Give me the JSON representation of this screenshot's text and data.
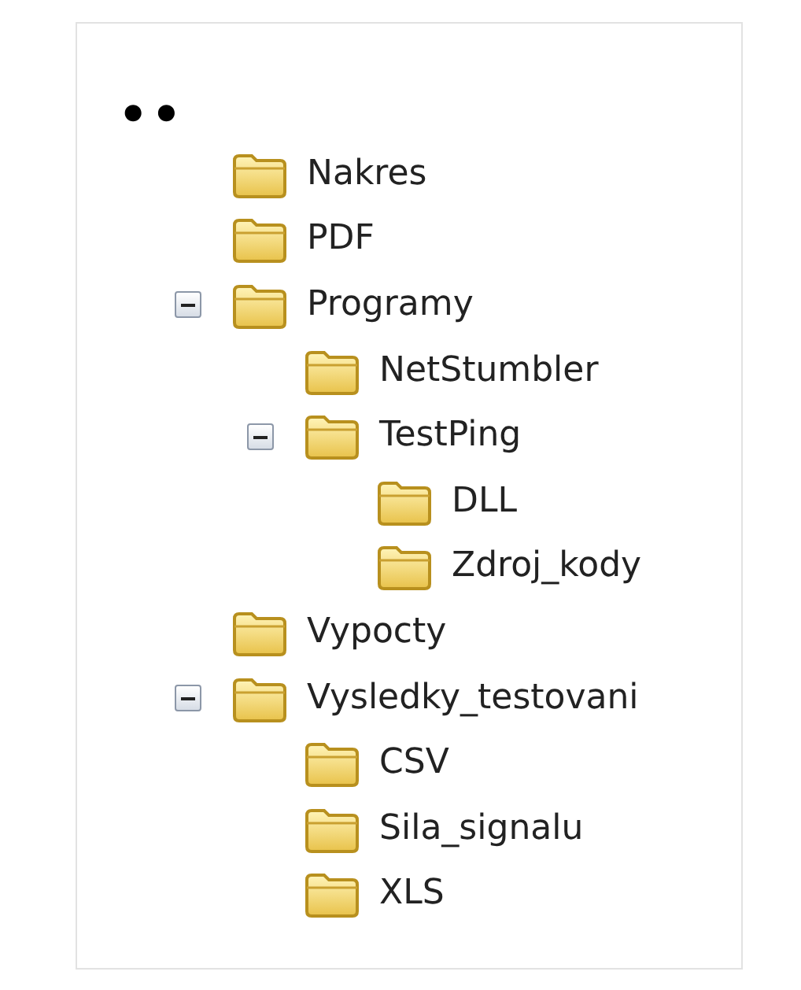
{
  "tree": {
    "root_label": "••",
    "children": [
      {
        "label": "Nakres"
      },
      {
        "label": "PDF"
      },
      {
        "label": "Programy",
        "expanded": true,
        "children": [
          {
            "label": "NetStumbler"
          },
          {
            "label": "TestPing",
            "expanded": true,
            "children": [
              {
                "label": "DLL"
              },
              {
                "label": "Zdroj_kody"
              }
            ]
          }
        ]
      },
      {
        "label": "Vypocty"
      },
      {
        "label": "Vysledky_testovani",
        "expanded": true,
        "children": [
          {
            "label": "CSV"
          },
          {
            "label": "Sila_signalu"
          },
          {
            "label": "XLS"
          }
        ]
      }
    ]
  }
}
